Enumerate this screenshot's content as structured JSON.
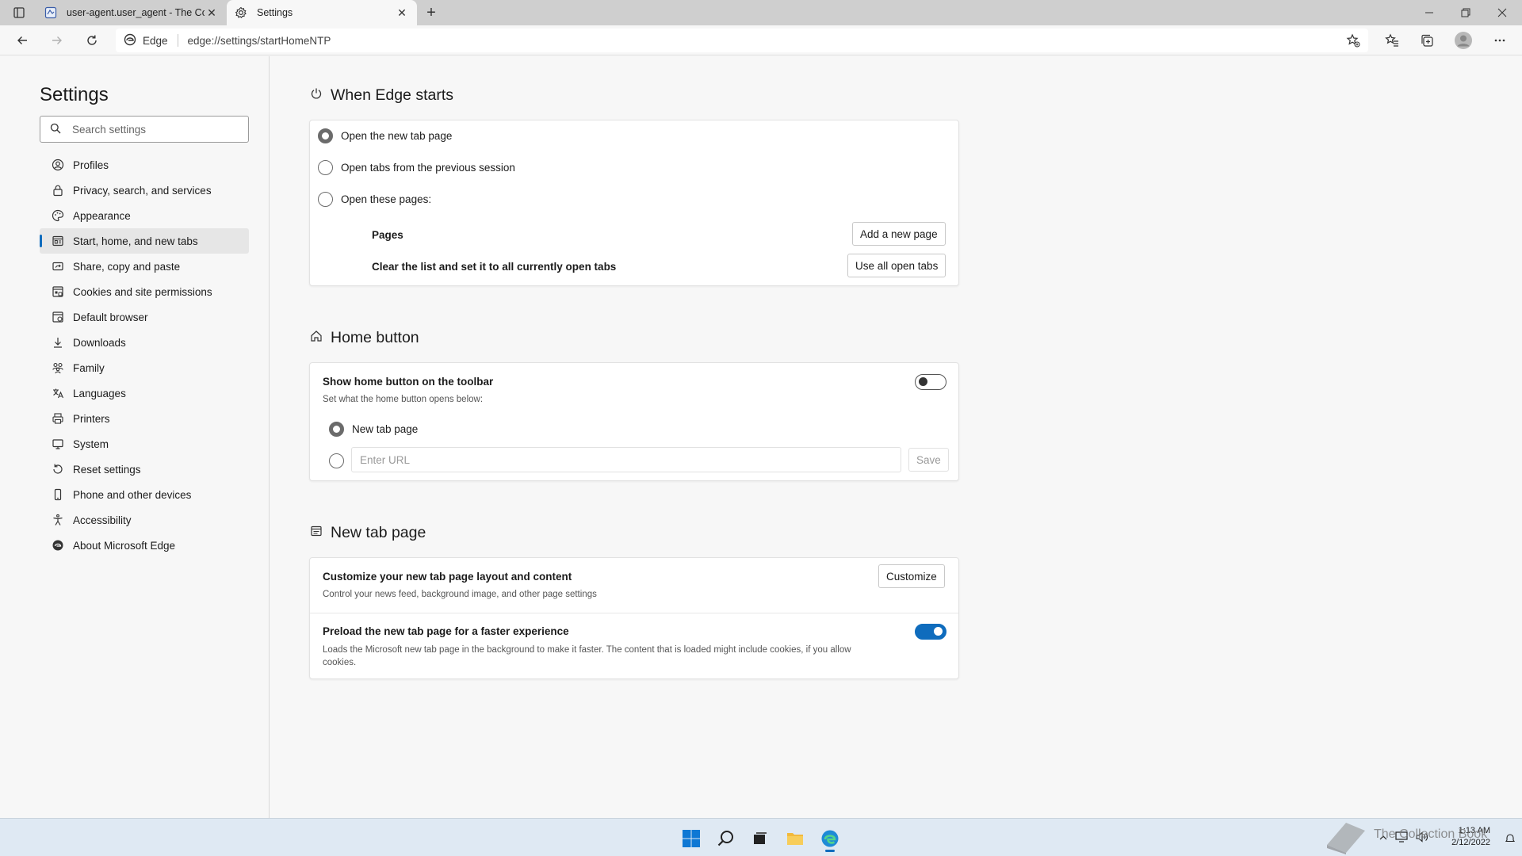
{
  "browser": {
    "tabs": [
      {
        "title": "user-agent.user_agent - The Coll",
        "active": false
      },
      {
        "title": "Settings",
        "active": true
      }
    ],
    "address": {
      "chip": "Edge",
      "url": "edge://settings/startHomeNTP"
    }
  },
  "sidebar": {
    "title": "Settings",
    "search_placeholder": "Search settings",
    "items": [
      {
        "label": "Profiles",
        "icon": "profile-icon"
      },
      {
        "label": "Privacy, search, and services",
        "icon": "lock-icon"
      },
      {
        "label": "Appearance",
        "icon": "palette-icon"
      },
      {
        "label": "Start, home, and new tabs",
        "icon": "start-tabs-icon",
        "selected": true
      },
      {
        "label": "Share, copy and paste",
        "icon": "share-icon"
      },
      {
        "label": "Cookies and site permissions",
        "icon": "cookies-icon"
      },
      {
        "label": "Default browser",
        "icon": "browser-icon"
      },
      {
        "label": "Downloads",
        "icon": "download-icon"
      },
      {
        "label": "Family",
        "icon": "family-icon"
      },
      {
        "label": "Languages",
        "icon": "languages-icon"
      },
      {
        "label": "Printers",
        "icon": "printer-icon"
      },
      {
        "label": "System",
        "icon": "system-icon"
      },
      {
        "label": "Reset settings",
        "icon": "reset-icon"
      },
      {
        "label": "Phone and other devices",
        "icon": "phone-icon"
      },
      {
        "label": "Accessibility",
        "icon": "accessibility-icon"
      },
      {
        "label": "About Microsoft Edge",
        "icon": "edge-icon"
      }
    ]
  },
  "when_edge_starts": {
    "title": "When Edge starts",
    "options": [
      {
        "label": "Open the new tab page",
        "checked": true
      },
      {
        "label": "Open tabs from the previous session",
        "checked": false
      },
      {
        "label": "Open these pages:",
        "checked": false
      }
    ],
    "pages_label": "Pages",
    "add_page_button": "Add a new page",
    "clear_label": "Clear the list and set it to all currently open tabs",
    "use_open_tabs_button": "Use all open tabs"
  },
  "home_button": {
    "title": "Home button",
    "show_label": "Show home button on the toolbar",
    "show_desc": "Set what the home button opens below:",
    "show_enabled": false,
    "new_tab_option": "New tab page",
    "url_placeholder": "Enter URL",
    "save_button": "Save"
  },
  "new_tab_page": {
    "title": "New tab page",
    "customize_label": "Customize your new tab page layout and content",
    "customize_desc": "Control your news feed, background image, and other page settings",
    "customize_button": "Customize",
    "preload_label": "Preload the new tab page for a faster experience",
    "preload_desc": "Loads the Microsoft new tab page in the background to make it faster. The content that is loaded might include cookies, if you allow cookies.",
    "preload_enabled": true
  },
  "taskbar": {
    "time": "1:13 AM",
    "date": "2/12/2022",
    "watermark": "The Collection Book"
  },
  "colors": {
    "accent": "#0f6cbd",
    "tabstrip": "#cfcfcf",
    "page_bg": "#f7f7f7",
    "taskbar": "#dfe9f3"
  }
}
